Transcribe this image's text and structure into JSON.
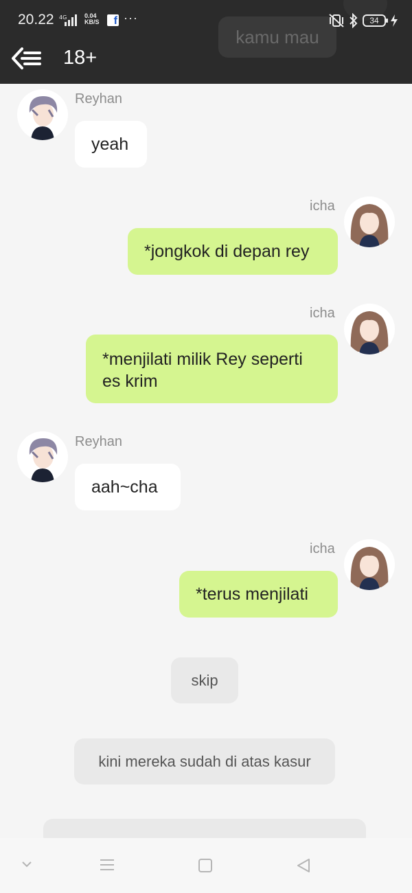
{
  "status_bar": {
    "time": "20.22",
    "network": "4G",
    "speed_value": "0.04",
    "speed_unit": "KB/S",
    "app_icon": "facebook-icon",
    "more": "···",
    "battery": "34"
  },
  "header": {
    "back_icon": "back-menu-icon",
    "title": "18+",
    "background_peek_text": "kamu mau"
  },
  "messages": [
    {
      "sender": "Reyhan",
      "side": "left",
      "text": "yeah"
    },
    {
      "sender": "icha",
      "side": "right",
      "text": "*jongkok di depan rey"
    },
    {
      "sender": "icha",
      "side": "right",
      "lines": [
        "*menjilati milik Rey seperti",
        "es krim"
      ]
    },
    {
      "sender": "Reyhan",
      "side": "left",
      "text": "aah~cha"
    },
    {
      "sender": "icha",
      "side": "right",
      "text": "*terus menjilati"
    }
  ],
  "options": [
    {
      "text": "skip"
    },
    {
      "text": "kini mereka sudah di atas kasur"
    }
  ],
  "colors": {
    "header_bg": "#2b2b2b",
    "chat_bg": "#f5f5f5",
    "incoming_bubble": "#ffffff",
    "outgoing_bubble": "#d5f590",
    "option_bubble": "#e9e9e9"
  },
  "nav_bar": {
    "icons": [
      "chevron-down-icon",
      "menu-icon",
      "home-square-icon",
      "back-triangle-icon"
    ]
  }
}
